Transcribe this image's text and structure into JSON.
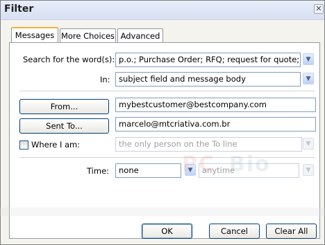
{
  "window": {
    "title": "Filter",
    "close_glyph": "✕"
  },
  "tabs": [
    {
      "label": "Messages",
      "active": true
    },
    {
      "label": "More Choices",
      "active": false
    },
    {
      "label": "Advanced",
      "active": false
    }
  ],
  "search": {
    "label": "Search for the word(s):",
    "value": "p.o.; Purchase Order; RFQ; request for quote;",
    "in_label": "In:",
    "in_value": "subject field and message body"
  },
  "from": {
    "button_label": "From...",
    "value": "mybestcustomer@bestcompany.com"
  },
  "sent_to": {
    "button_label": "Sent To...",
    "value": "marcelo@mtcriativa.com.br"
  },
  "where_i_am": {
    "label": "Where I am:",
    "checked": false,
    "value": "the only person on the To line"
  },
  "time": {
    "label": "Time:",
    "value": "none",
    "range_value": "anytime"
  },
  "buttons": {
    "ok": "OK",
    "cancel": "Cancel",
    "clear_all": "Clear All"
  },
  "icons": {
    "dropdown": "chevron-down-icon",
    "close": "close-icon"
  },
  "watermark": {
    "text_a": "PC",
    "text_b": "Bio"
  }
}
